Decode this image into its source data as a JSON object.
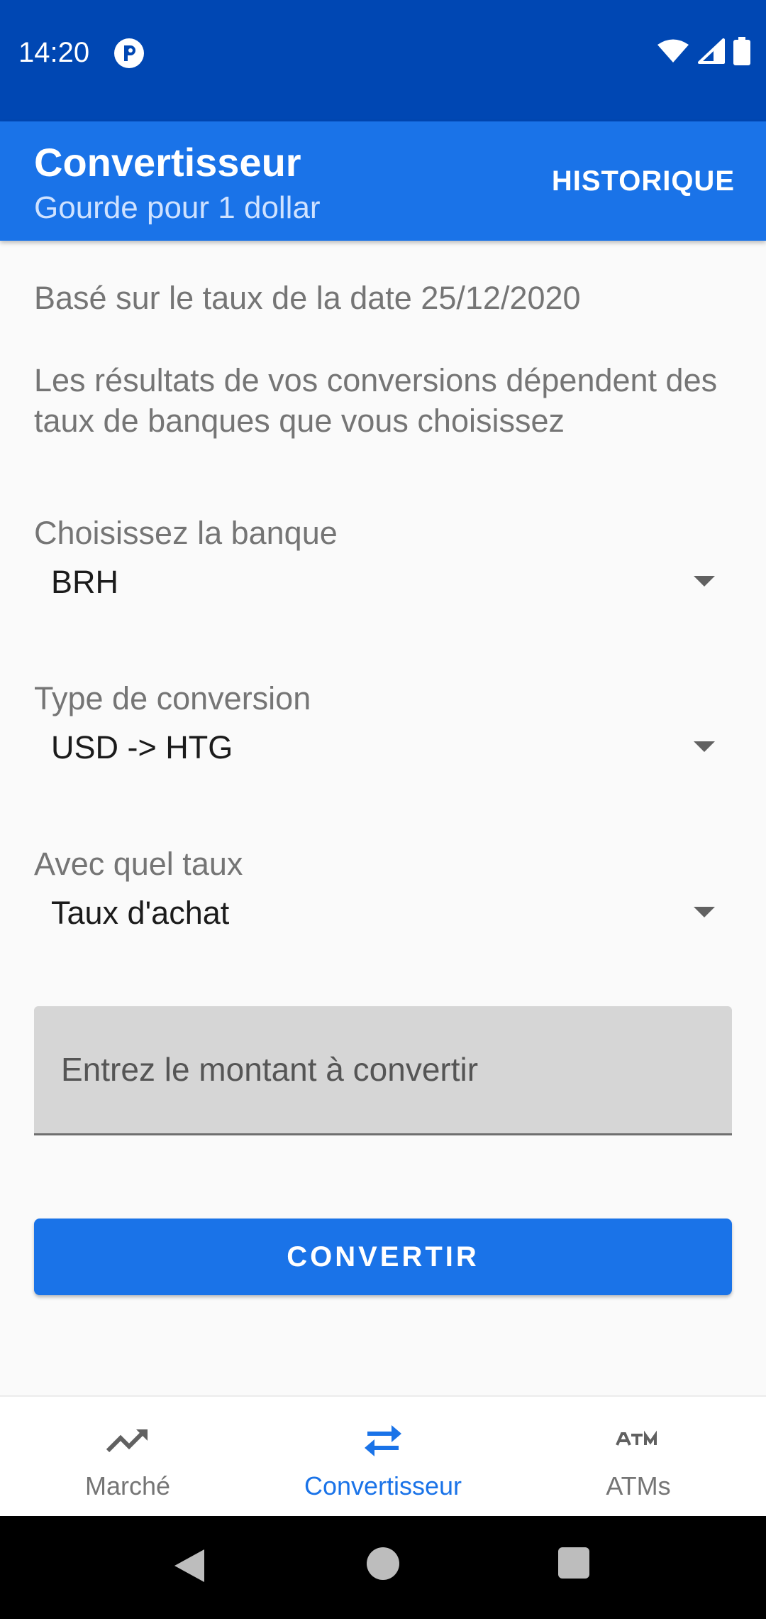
{
  "status_bar": {
    "time": "14:20",
    "app_icon": "p-circle-icon",
    "icons": [
      "wifi-icon",
      "signal-icon",
      "battery-icon"
    ]
  },
  "app_bar": {
    "title": "Convertisseur",
    "subtitle": "Gourde pour 1 dollar",
    "action_label": "HISTORIQUE"
  },
  "info": {
    "date_text": "Basé sur le taux de la date 25/12/2020",
    "disclaimer": "Les résultats de vos conversions dépendent des taux de banques que vous choisissez"
  },
  "form": {
    "bank": {
      "label": "Choisissez la banque",
      "value": "BRH"
    },
    "conversion_type": {
      "label": "Type de conversion",
      "value": "USD -> HTG"
    },
    "rate": {
      "label": "Avec quel taux",
      "value": "Taux d'achat"
    },
    "amount": {
      "placeholder": "Entrez le montant à convertir",
      "value": ""
    },
    "submit_label": "CONVERTIR"
  },
  "bottom_nav": {
    "items": [
      {
        "label": "Marché",
        "icon": "trending-up-icon",
        "active": false
      },
      {
        "label": "Convertisseur",
        "icon": "swap-arrows-icon",
        "active": true
      },
      {
        "label": "ATMs",
        "icon": "atm-icon",
        "active": false
      }
    ]
  },
  "colors": {
    "status_bar": "#0047b3",
    "primary": "#1a73e8",
    "text_secondary": "#757575",
    "input_background": "#d6d6d6"
  }
}
